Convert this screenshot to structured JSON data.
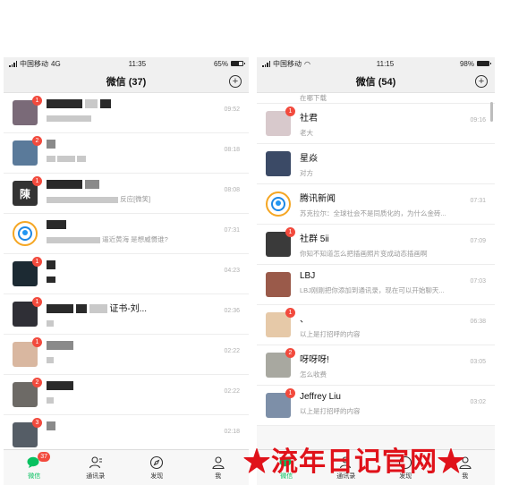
{
  "left": {
    "status": {
      "carrier": "中国移动",
      "network": "4G",
      "time": "11:35",
      "battery": "65%",
      "battery_level": 0.65
    },
    "title": "微信 (37)",
    "chats": [
      {
        "name": "",
        "preview": "",
        "time": "09:52",
        "badge": "1",
        "avatar_color": "#7a6a78",
        "avatar_text": ""
      },
      {
        "name": "",
        "preview": "",
        "time": "08:18",
        "badge": "2",
        "avatar_color": "#5a7a9a",
        "avatar_text": ""
      },
      {
        "name": "",
        "preview": "反应[微笑]",
        "time": "08:08",
        "badge": "1",
        "avatar_color": "#333333",
        "avatar_text": "陳"
      },
      {
        "name": "",
        "preview": "逼近黄海 是想威慑谁?",
        "time": "07:31",
        "badge": "",
        "avatar_color": "#ffffff",
        "avatar_text": ""
      },
      {
        "name": "",
        "preview": "",
        "time": "04:23",
        "badge": "1",
        "avatar_color": "#1c2a33",
        "avatar_text": ""
      },
      {
        "name": "证书-刘...",
        "preview": "",
        "time": "02:36",
        "badge": "1",
        "avatar_color": "#2f2f36",
        "avatar_text": ""
      },
      {
        "name": "",
        "preview": "",
        "time": "02:22",
        "badge": "1",
        "avatar_color": "#d9b7a0",
        "avatar_text": ""
      },
      {
        "name": "",
        "preview": "",
        "time": "02:22",
        "badge": "2",
        "avatar_color": "#6d6a66",
        "avatar_text": ""
      },
      {
        "name": "",
        "preview": "",
        "time": "02:18",
        "badge": "3",
        "avatar_color": "#555d66",
        "avatar_text": ""
      }
    ],
    "tabs": [
      {
        "label": "微信",
        "badge": "37"
      },
      {
        "label": "通讯录",
        "badge": ""
      },
      {
        "label": "发现",
        "badge": ""
      },
      {
        "label": "我",
        "badge": ""
      }
    ]
  },
  "right": {
    "status": {
      "carrier": "中国移动",
      "network": "",
      "time": "11:15",
      "battery": "98%",
      "battery_level": 0.98
    },
    "title": "微信 (54)",
    "top_preview": "在哪下载",
    "chats": [
      {
        "name": "社君",
        "preview": "老大",
        "time": "09:16",
        "badge": "1",
        "avatar_color": "#d8c9cc",
        "avatar_text": ""
      },
      {
        "name": "星焱",
        "preview": "对方",
        "time": "",
        "badge": "",
        "avatar_color": "#3b4a66",
        "avatar_text": ""
      },
      {
        "name": "腾讯新闻",
        "preview": "苏克拉尔：全球社会不是同质化的，为什么金砖...",
        "time": "07:31",
        "badge": "",
        "avatar_color": "#ffffff",
        "avatar_text": ""
      },
      {
        "name": "社群 5ii",
        "preview": "你知不知道怎么把插画照片变成动态插画啊",
        "time": "07:09",
        "badge": "1",
        "avatar_color": "#3a3a3a",
        "avatar_text": ""
      },
      {
        "name": "LBJ",
        "preview": "LBJ刚刚把你添加到通讯录，现在可以开始聊天...",
        "time": "07:03",
        "badge": "",
        "avatar_color": "#9a5a4a",
        "avatar_text": ""
      },
      {
        "name": "、",
        "preview": "以上是打招呼的内容",
        "time": "06:38",
        "badge": "1",
        "avatar_color": "#e6c9a8",
        "avatar_text": ""
      },
      {
        "name": "呀呀呀!",
        "preview": "怎么收费",
        "time": "03:05",
        "badge": "2",
        "avatar_color": "#a8a8a0",
        "avatar_text": ""
      },
      {
        "name": "Jeffrey Liu",
        "preview": "以上是打招呼的内容",
        "time": "03:02",
        "badge": "1",
        "avatar_color": "#7d8fa8",
        "avatar_text": ""
      }
    ],
    "tabs": [
      {
        "label": "微信"
      },
      {
        "label": "通讯录"
      },
      {
        "label": "发现"
      },
      {
        "label": "我"
      }
    ]
  },
  "watermark": "★流年日记官网★",
  "colors": {
    "accent": "#07c160",
    "badge": "#f24a3d"
  }
}
